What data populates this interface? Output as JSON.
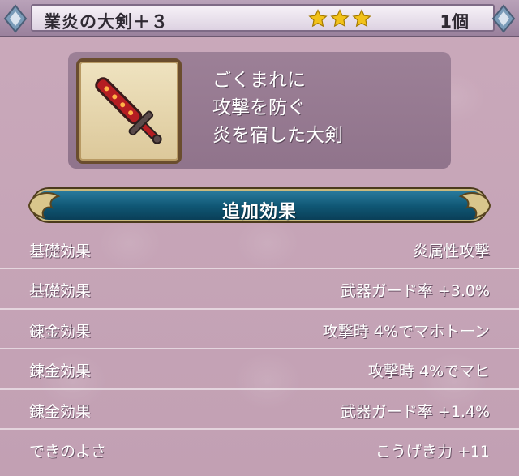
{
  "header": {
    "title": "業炎の大剣＋３",
    "stars": 3,
    "count": "1個"
  },
  "item": {
    "icon": "sword-icon",
    "description": [
      "ごくまれに",
      "攻撃を防ぐ",
      "炎を宿した大剣"
    ]
  },
  "section": {
    "label": "追加効果"
  },
  "effects": [
    {
      "label": "基礎効果",
      "value": "炎属性攻撃"
    },
    {
      "label": "基礎効果",
      "value": "武器ガード率 +3.0%"
    },
    {
      "label": "錬金効果",
      "value": "攻撃時 4%でマホトーン"
    },
    {
      "label": "錬金効果",
      "value": "攻撃時 4%でマヒ"
    },
    {
      "label": "錬金効果",
      "value": "武器ガード率 +1.4%"
    },
    {
      "label": "できのよさ",
      "value": "こうげき力 +11"
    }
  ],
  "colors": {
    "background": "#c7a4b6",
    "banner": "#0f5673",
    "star": "#f2c21a"
  }
}
